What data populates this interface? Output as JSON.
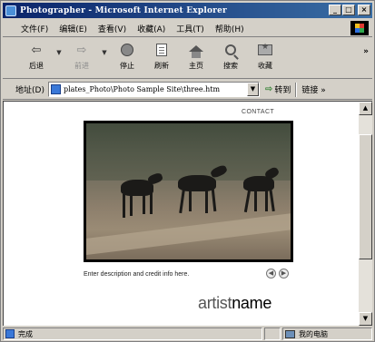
{
  "window": {
    "title": "Photographer - Microsoft Internet Explorer"
  },
  "menu": {
    "items": [
      "文件(F)",
      "编辑(E)",
      "查看(V)",
      "收藏(A)",
      "工具(T)",
      "帮助(H)"
    ]
  },
  "toolbar": {
    "back": "后退",
    "forward": "前进",
    "stop": "停止",
    "refresh": "刷新",
    "home": "主页",
    "search": "搜索",
    "favorites": "收藏",
    "more": "»"
  },
  "address": {
    "label": "地址(D)",
    "url": "plates_Photo\\Photo Sample Site\\three.htm",
    "go": "转到",
    "links": "链接 »"
  },
  "page": {
    "contact": "CONTACT",
    "caption": "Enter description and credit info here.",
    "artist_light": "artist",
    "artist_bold": "name"
  },
  "status": {
    "text": "完成",
    "zone": "我的电脑"
  },
  "colors": {
    "titlebar_start": "#0a246a",
    "titlebar_end": "#3a6ea5",
    "chrome": "#d4d0c8"
  },
  "icons": {
    "back": "arrow-left-icon",
    "forward": "arrow-right-icon",
    "stop": "stop-icon",
    "refresh": "refresh-icon",
    "home": "home-icon",
    "search": "search-icon",
    "favorites": "favorites-icon",
    "go": "go-arrow-icon"
  }
}
